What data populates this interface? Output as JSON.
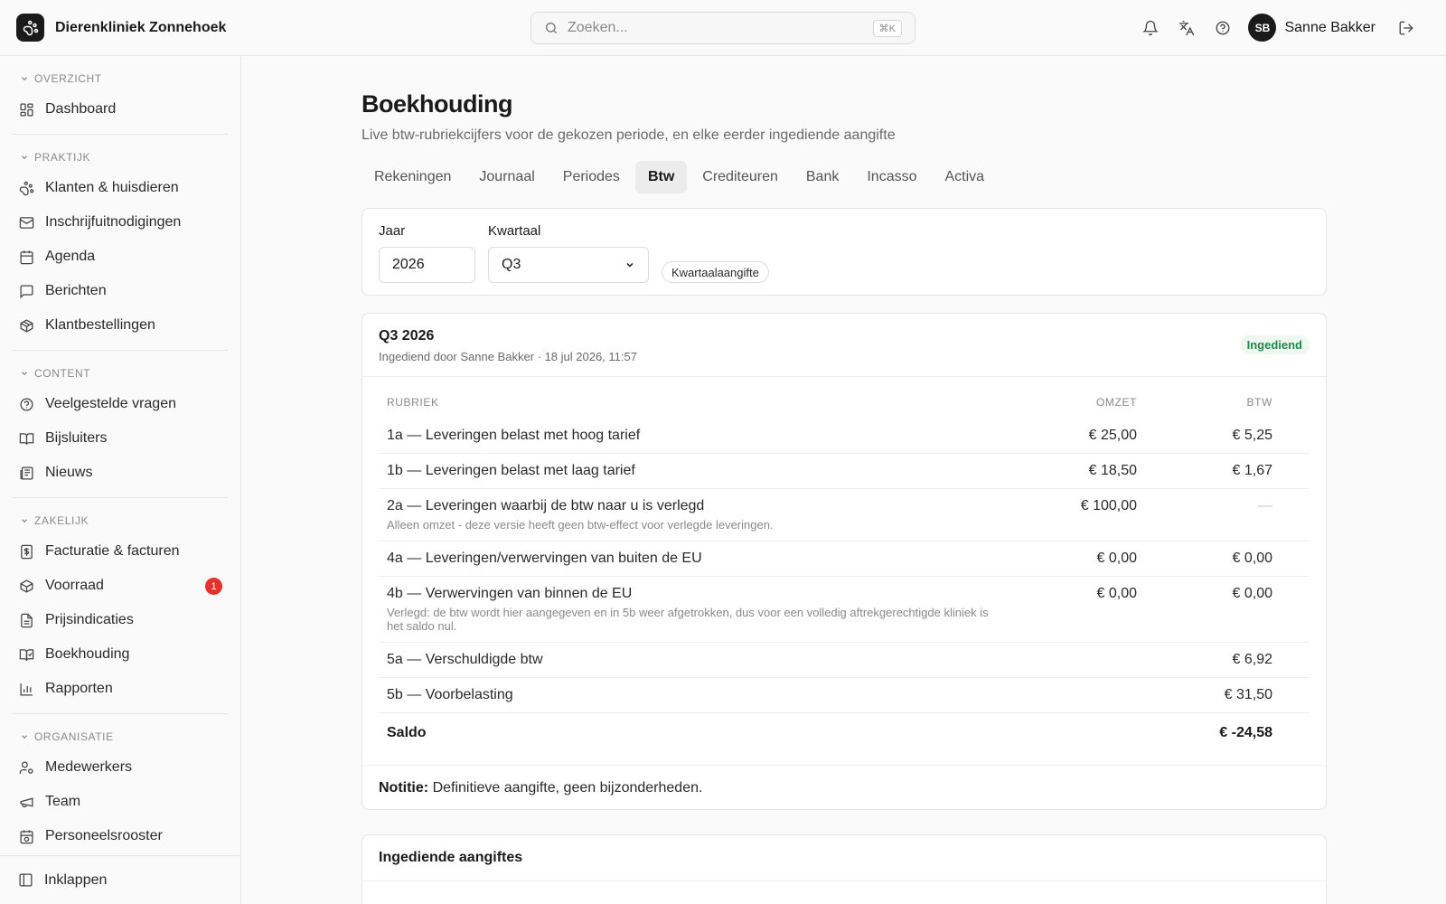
{
  "app": {
    "name": "Dierenkliniek Zonnehoek"
  },
  "search": {
    "placeholder": "Zoeken...",
    "shortcut": "⌘K"
  },
  "user": {
    "initials": "SB",
    "name": "Sanne Bakker"
  },
  "sidebar": {
    "sections": [
      {
        "title": "OVERZICHT",
        "items": [
          {
            "label": "Dashboard",
            "icon": "dashboard-icon"
          }
        ]
      },
      {
        "title": "PRAKTIJK",
        "items": [
          {
            "label": "Klanten & huisdieren",
            "icon": "paw-icon"
          },
          {
            "label": "Inschrijfuitnodigingen",
            "icon": "mail-icon"
          },
          {
            "label": "Agenda",
            "icon": "calendar-icon"
          },
          {
            "label": "Berichten",
            "icon": "message-icon"
          },
          {
            "label": "Klantbestellingen",
            "icon": "package-icon"
          }
        ]
      },
      {
        "title": "CONTENT",
        "items": [
          {
            "label": "Veelgestelde vragen",
            "icon": "help-circle-icon"
          },
          {
            "label": "Bijsluiters",
            "icon": "book-icon"
          },
          {
            "label": "Nieuws",
            "icon": "newspaper-icon"
          }
        ]
      },
      {
        "title": "ZAKELIJK",
        "items": [
          {
            "label": "Facturatie & facturen",
            "icon": "invoice-icon"
          },
          {
            "label": "Voorraad",
            "icon": "box-icon",
            "badge": "1"
          },
          {
            "label": "Prijsindicaties",
            "icon": "price-list-icon"
          },
          {
            "label": "Boekhouding",
            "icon": "ledger-icon"
          },
          {
            "label": "Rapporten",
            "icon": "bar-chart-icon"
          }
        ]
      },
      {
        "title": "ORGANISATIE",
        "items": [
          {
            "label": "Medewerkers",
            "icon": "user-settings-icon"
          },
          {
            "label": "Team",
            "icon": "megaphone-icon"
          },
          {
            "label": "Personeelsrooster",
            "icon": "schedule-icon"
          }
        ]
      }
    ],
    "collapse_label": "Inklappen"
  },
  "page": {
    "title": "Boekhouding",
    "subtitle": "Live btw-rubriekcijfers voor de gekozen periode, en elke eerder ingediende aangifte",
    "tabs": [
      "Rekeningen",
      "Journaal",
      "Periodes",
      "Btw",
      "Crediteuren",
      "Bank",
      "Incasso",
      "Activa"
    ],
    "active_tab": "Btw"
  },
  "filters": {
    "year_label": "Jaar",
    "year_value": "2026",
    "quarter_label": "Kwartaal",
    "quarter_value": "Q3",
    "type_pill": "Kwartaalaangifte"
  },
  "report": {
    "title": "Q3 2026",
    "meta": "Ingediend door Sanne Bakker · 18 jul 2026, 11:57",
    "status": "Ingediend",
    "columns": {
      "rubriek": "RUBRIEK",
      "omzet": "OMZET",
      "btw": "BTW"
    },
    "rows": [
      {
        "label": "1a — Leveringen belast met hoog tarief",
        "omzet": "€ 25,00",
        "btw": "€ 5,25",
        "note": ""
      },
      {
        "label": "1b — Leveringen belast met laag tarief",
        "omzet": "€ 18,50",
        "btw": "€ 1,67",
        "note": ""
      },
      {
        "label": "2a — Leveringen waarbij de btw naar u is verlegd",
        "omzet": "€ 100,00",
        "btw": "—",
        "note": "Alleen omzet - deze versie heeft geen btw-effect voor verlegde leveringen."
      },
      {
        "label": "4a — Leveringen/verwervingen van buiten de EU",
        "omzet": "€ 0,00",
        "btw": "€ 0,00",
        "note": ""
      },
      {
        "label": "4b — Verwervingen van binnen de EU",
        "omzet": "€ 0,00",
        "btw": "€ 0,00",
        "note": "Verlegd: de btw wordt hier aangegeven en in 5b weer afgetrokken, dus voor een volledig aftrekgerechtigde kliniek is het saldo nul."
      },
      {
        "label": "5a — Verschuldigde btw",
        "omzet": "",
        "btw": "€ 6,92",
        "note": ""
      },
      {
        "label": "5b — Voorbelasting",
        "omzet": "",
        "btw": "€ 31,50",
        "note": ""
      }
    ],
    "total": {
      "label": "Saldo",
      "btw": "€ -24,58"
    },
    "note_label": "Notitie:",
    "note_text": "Definitieve aangifte, geen bijzonderheden."
  },
  "submitted": {
    "title": "Ingediende aangiftes"
  },
  "colors": {
    "accent": "#1a1a1a",
    "status_green": "#1e8a4c",
    "badge_red": "#e5322d"
  }
}
